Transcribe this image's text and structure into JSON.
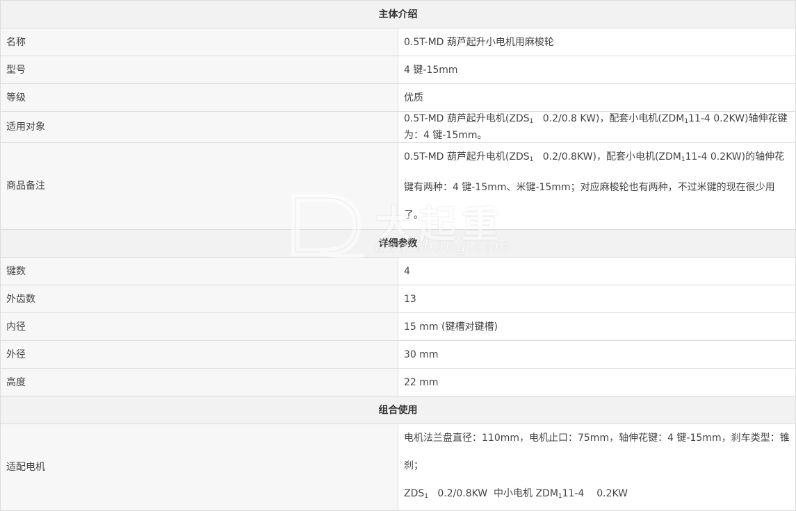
{
  "sections": {
    "intro": "主体介绍",
    "details": "详细参数",
    "combo": "组合使用"
  },
  "intro_rows": [
    {
      "label": "名称",
      "value": "0.5T-MD 葫芦起升小电机用麻梭轮"
    },
    {
      "label": "型号",
      "value": "4 键-15mm"
    },
    {
      "label": "等级",
      "value": "优质"
    },
    {
      "label": "适用对象",
      "value_parts": [
        "0.5T-MD 葫芦起升电机(ZDS",
        "1",
        "   0.2/0.8 KW)，配套小电机(ZDM",
        "1",
        "11-4 0.2KW)轴伸花键为：4 键-15mm。"
      ]
    },
    {
      "label": "商品备注",
      "value_parts": [
        "0.5T-MD 葫芦起升电机(ZDS",
        "1",
        "   0.2/0.8KW)，配套小电机(ZDM",
        "1",
        "11-4 0.2KW)的轴伸花键有两种：4 键-15mm、米键-15mm；对应麻梭轮也有两种，不过米键的现在很少用了。"
      ]
    }
  ],
  "detail_rows": [
    {
      "label": "键数",
      "value": "4"
    },
    {
      "label": "外齿数",
      "value": "13"
    },
    {
      "label": "内径",
      "value": "15 mm (键槽对键槽)"
    },
    {
      "label": "外径",
      "value": "30 mm"
    },
    {
      "label": "高度",
      "value": "22 mm"
    }
  ],
  "combo_rows": [
    {
      "label": "适配电机",
      "line1": "电机法兰盘直径：110mm，电机止口：75mm，轴伸花键：4 键-15mm，刹车类型：锥刹；",
      "line2_parts": [
        "ZDS",
        "1",
        "   0.2/0.8KW  中小电机 ZDM",
        "1",
        "11-4    0.2KW"
      ]
    }
  ],
  "watermark": {
    "cn": "大起重",
    "en": "daqizhong.com"
  }
}
